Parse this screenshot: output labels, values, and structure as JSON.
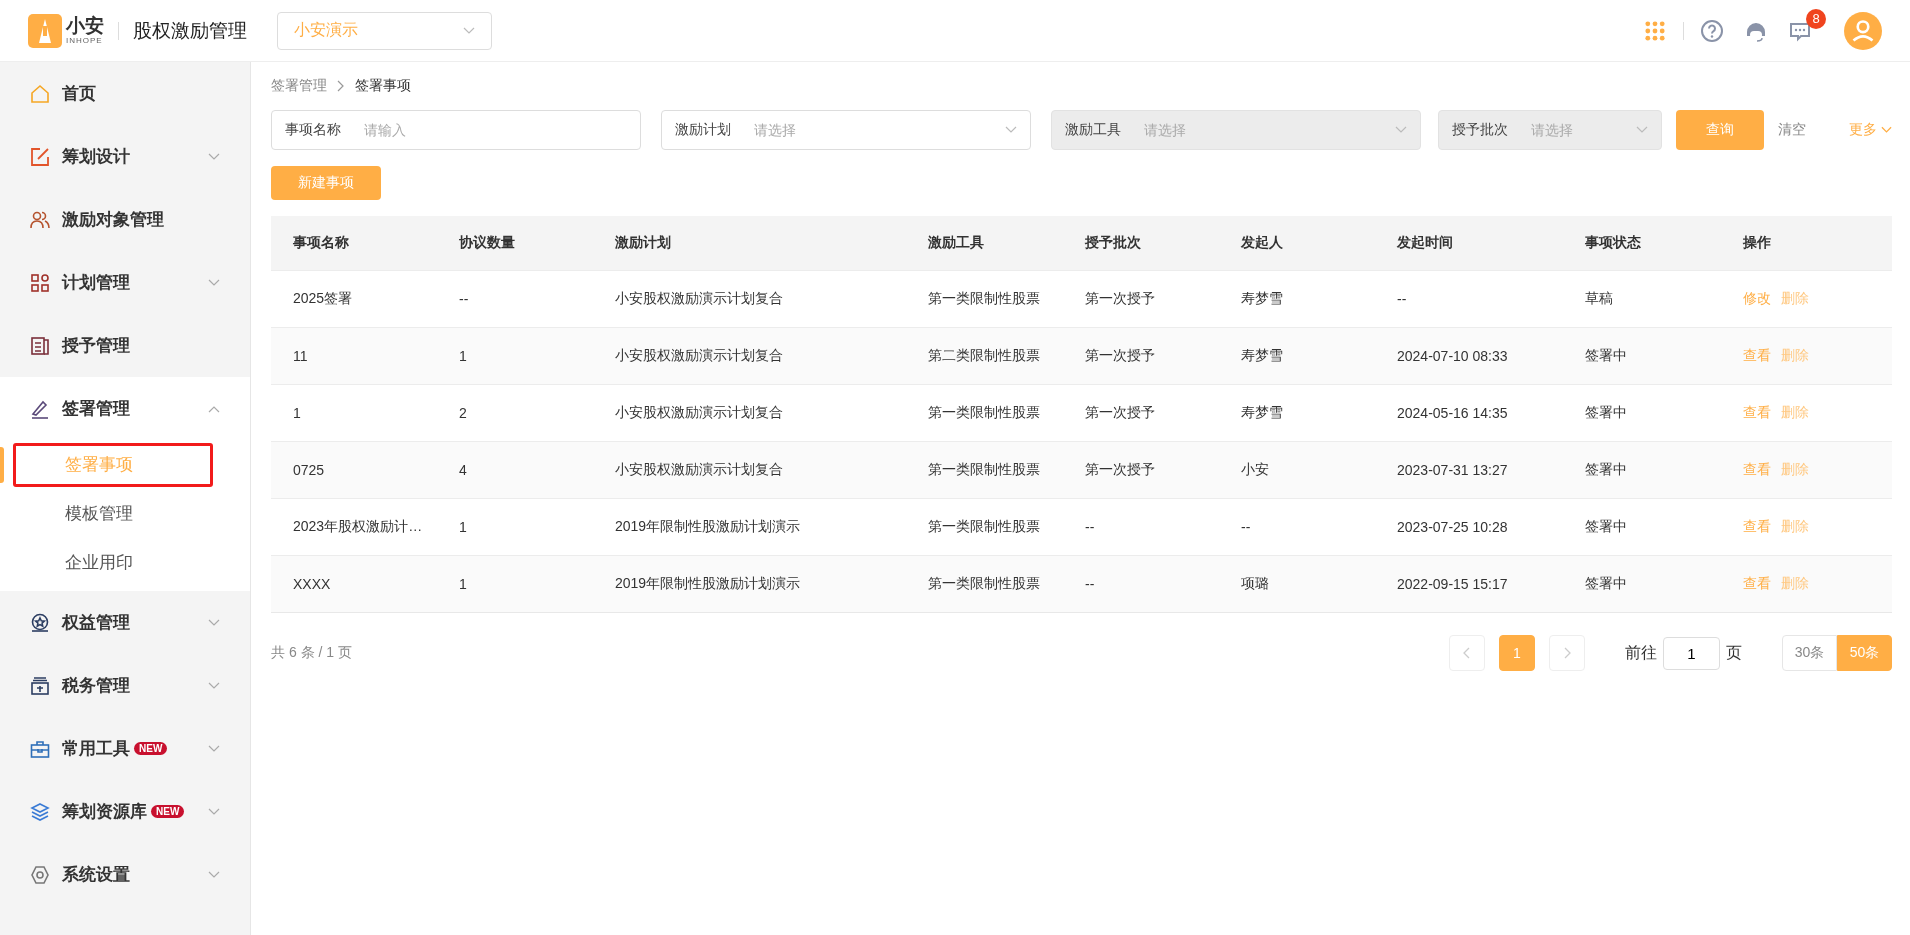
{
  "header": {
    "logo": {
      "name": "小安",
      "subtitle": "INHOPE"
    },
    "title": "股权激励管理",
    "company_select": {
      "value": "小安演示"
    },
    "message_badge": "8"
  },
  "sidebar": {
    "items": [
      {
        "label": "首页",
        "kind": "link"
      },
      {
        "label": "筹划设计",
        "kind": "group",
        "expanded": false
      },
      {
        "label": "激励对象管理",
        "kind": "link"
      },
      {
        "label": "计划管理",
        "kind": "group",
        "expanded": false
      },
      {
        "label": "授予管理",
        "kind": "link"
      },
      {
        "label": "签署管理",
        "kind": "group",
        "expanded": true,
        "children": [
          {
            "label": "签署事项",
            "selected": true
          },
          {
            "label": "模板管理",
            "selected": false
          },
          {
            "label": "企业用印",
            "selected": false
          }
        ]
      },
      {
        "label": "权益管理",
        "kind": "group",
        "expanded": false
      },
      {
        "label": "税务管理",
        "kind": "group",
        "expanded": false
      },
      {
        "label": "常用工具",
        "kind": "group",
        "expanded": false,
        "badge": "NEW"
      },
      {
        "label": "筹划资源库",
        "kind": "group",
        "expanded": false,
        "badge": "NEW"
      },
      {
        "label": "系统设置",
        "kind": "group",
        "expanded": false
      }
    ]
  },
  "breadcrumb": [
    "签署管理",
    "签署事项"
  ],
  "filters": [
    {
      "label": "事项名称",
      "kind": "input",
      "placeholder": "请输入",
      "disabled": false
    },
    {
      "label": "激励计划",
      "kind": "select",
      "placeholder": "请选择",
      "disabled": false
    },
    {
      "label": "激励工具",
      "kind": "select",
      "placeholder": "请选择",
      "disabled": true
    },
    {
      "label": "授予批次",
      "kind": "select",
      "placeholder": "请选择",
      "disabled": true
    }
  ],
  "buttons": {
    "query": "查询",
    "clear": "清空",
    "more": "更多",
    "new": "新建事项"
  },
  "table": {
    "columns": [
      "事项名称",
      "协议数量",
      "激励计划",
      "激励工具",
      "授予批次",
      "发起人",
      "发起时间",
      "事项状态",
      "操作"
    ],
    "rows": [
      {
        "cells": [
          "2025签署",
          "--",
          "小安股权激励演示计划复合",
          "第一类限制性股票",
          "第一次授予",
          "寿梦雪",
          "--",
          "草稿"
        ],
        "actions": [
          {
            "label": "修改",
            "kind": "primary"
          },
          {
            "label": "删除",
            "kind": "danger"
          }
        ]
      },
      {
        "cells": [
          "11",
          "1",
          "小安股权激励演示计划复合",
          "第二类限制性股票",
          "第一次授予",
          "寿梦雪",
          "2024-07-10 08:33",
          "签署中"
        ],
        "actions": [
          {
            "label": "查看",
            "kind": "primary"
          },
          {
            "label": "删除",
            "kind": "danger"
          }
        ]
      },
      {
        "cells": [
          "1",
          "2",
          "小安股权激励演示计划复合",
          "第一类限制性股票",
          "第一次授予",
          "寿梦雪",
          "2024-05-16 14:35",
          "签署中"
        ],
        "actions": [
          {
            "label": "查看",
            "kind": "primary"
          },
          {
            "label": "删除",
            "kind": "danger"
          }
        ]
      },
      {
        "cells": [
          "0725",
          "4",
          "小安股权激励演示计划复合",
          "第一类限制性股票",
          "第一次授予",
          "小安",
          "2023-07-31 13:27",
          "签署中"
        ],
        "actions": [
          {
            "label": "查看",
            "kind": "primary"
          },
          {
            "label": "删除",
            "kind": "danger"
          }
        ]
      },
      {
        "cells": [
          "2023年股权激励计…",
          "1",
          "2019年限制性股激励计划演示",
          "第一类限制性股票",
          "--",
          "--",
          "2023-07-25 10:28",
          "签署中"
        ],
        "actions": [
          {
            "label": "查看",
            "kind": "primary"
          },
          {
            "label": "删除",
            "kind": "danger"
          }
        ]
      },
      {
        "cells": [
          "XXXX",
          "1",
          "2019年限制性股激励计划演示",
          "第一类限制性股票",
          "--",
          "项璐",
          "2022-09-15 15:17",
          "签署中"
        ],
        "actions": [
          {
            "label": "查看",
            "kind": "primary"
          },
          {
            "label": "删除",
            "kind": "danger"
          }
        ]
      }
    ]
  },
  "pagination": {
    "total": "共 6 条 / 1 页",
    "pages": [
      {
        "label": "1",
        "selected": true
      }
    ],
    "goto_label": "前往",
    "goto_value": "1",
    "goto_suffix": "页",
    "page_sizes": [
      {
        "label": "30条",
        "selected": false
      },
      {
        "label": "50条",
        "selected": true
      }
    ]
  }
}
